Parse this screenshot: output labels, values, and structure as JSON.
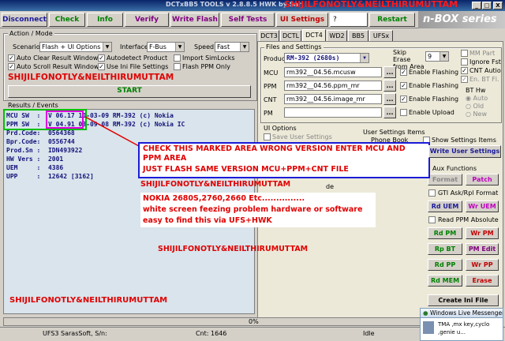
{
  "titlebar": {
    "title": "DCTxBB5 TOOLS v 2.8.8.5 HWK by Sar",
    "overlay": "SHIJILFONOTLY&NEILTHIRUMUTTAM",
    "controls": [
      "_",
      "□",
      "X"
    ]
  },
  "toolbar": {
    "buttons": [
      "Disconnect",
      "Check",
      "Info",
      "Verify",
      "Write Flash",
      "Self Tests",
      "UI Settings"
    ],
    "help": "?",
    "restart": "Restart",
    "brand": "n-BOX series"
  },
  "action": {
    "legend": "Action / Mode",
    "scenario_label": "Scenario",
    "scenario_value": "Flash + UI Options",
    "interface_label": "Interface",
    "interface_value": "F-Bus",
    "speed_label": "Speed",
    "speed_value": "Fast",
    "checks": [
      {
        "label": "Auto Clear Result Window",
        "checked": true
      },
      {
        "label": "Autodetect Product",
        "checked": true
      },
      {
        "label": "Import SimLocks",
        "checked": false
      },
      {
        "label": "Auto Scroll Result Window",
        "checked": true
      },
      {
        "label": "Use Ini File Settings",
        "checked": true
      },
      {
        "label": "Flash PPM Only",
        "checked": false
      }
    ],
    "overlay": "SHIJILFONOTLY&NEILTHIRUMUTTAM",
    "start": "START"
  },
  "results": {
    "legend": "Results / Events",
    "lines": [
      "MCU SW  :  V 06.17 10-03-09 RM-392 (c) Nokia",
      "PPM SW  :  V 04.91 03-09-08 RM-392 (c) Nokia IC",
      "Prd.Code:  0564368",
      "Bpr.Code:  0556744",
      "Prod.Sn :  IDN493922",
      "HW Vers :  2001",
      "UEM     :  4386",
      "UPP     :  12642 [3162]"
    ]
  },
  "tabs": [
    "DCT3",
    "DCTL",
    "DCT4",
    "WD2",
    "BB5",
    "UFSx"
  ],
  "files": {
    "legend": "Files and Settings",
    "product_label": "Product",
    "product_value": "RM-392 (2680s)",
    "skip_label": "Skip Erase from Area",
    "skip_value": "9",
    "rows": [
      {
        "label": "MCU",
        "value": "rm392__04.56.mcusw",
        "check": "Enable Flashing"
      },
      {
        "label": "PPM",
        "value": "rm392__04.56.ppm_mr",
        "check": "Enable Flashing"
      },
      {
        "label": "CNT",
        "value": "rm392__04.56.image_mr",
        "check": "Enable Flashing"
      },
      {
        "label": "PM",
        "value": "",
        "check": "Enable Upload"
      }
    ],
    "right_checks": [
      "MM Part",
      "Ignore Fst",
      "CNT Autio",
      "En. BT Fl."
    ],
    "bt_label": "BT Hw",
    "bt_opts": [
      "Auto",
      "Old",
      "New"
    ]
  },
  "ui_options": {
    "legend": "UI Options",
    "save": "Save User Settings",
    "partial": "de"
  },
  "user_items": {
    "legend": "User Settings Items",
    "phonebook": "Phone Book",
    "show": "Show Settings Items",
    "write": "Write User Settings"
  },
  "aux": {
    "legend": "Aux Functions",
    "format": "Format",
    "patch": "Patch",
    "gti": "GTI Ask/Rpl Format",
    "rd_uem": "Rd UEM",
    "wr_uem": "Wr UEM",
    "read_ppm": "Read PPM Absolute",
    "buttons": [
      [
        "Rd PM",
        "Wr PM"
      ],
      [
        "Rp BT",
        "PM Edit"
      ],
      [
        "Rd PP",
        "Wr PP"
      ],
      [
        "Rd MEM",
        "Erase"
      ]
    ],
    "create_ini": "Create Ini File"
  },
  "overlay_box": {
    "line1": "CHECK THIS MARKED AREA WRONG VERSION ENTER MCU AND",
    "line2": "PPM AREA",
    "line3": "JUST FLASH SAME VERSION MCU+PPM+CNT FILE"
  },
  "notes": {
    "n1": "SHIJILFONOTLY&NEILTHIRUMUTTAM",
    "n2": "SHIJILFONOTLY&NEILTHIRUMUTTAM",
    "n3": "NOKIA 2680S,2760,2660 Etc...............",
    "n4": "white screen feezing problem hardware or software",
    "n5": "easy to find this via UFS+HWK",
    "n6": "SHIJILFONOTLY&NEILTHIRUMUTTAM"
  },
  "progress": {
    "label": "0%",
    "value": 0
  },
  "status": {
    "serial": "UFS3 SarasSoft, S/n:",
    "cnt": "Cnt: 1646",
    "state": "Idle"
  },
  "msn": {
    "title": "Windows Live Messenger",
    "text1": "TMA ,mx key,cyclo",
    "text2": ",genie u..."
  },
  "colors": {
    "accent_red": "#e00000",
    "highlight_blue": "#1b1bd8",
    "log_bg": "#d9e4ec"
  }
}
